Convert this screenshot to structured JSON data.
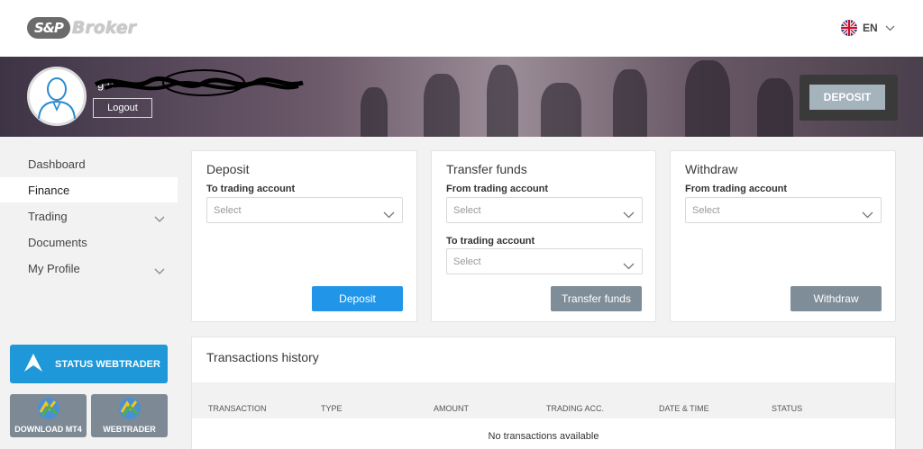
{
  "header": {
    "logo_mark": "S&P",
    "logo_text": "Broker",
    "language": "EN"
  },
  "banner": {
    "username": "g u",
    "logout_label": "Logout",
    "deposit_label": "DEPOSIT"
  },
  "sidebar": {
    "items": [
      {
        "label": "Dashboard"
      },
      {
        "label": "Finance"
      },
      {
        "label": "Trading"
      },
      {
        "label": "Documents"
      },
      {
        "label": "My Profile"
      }
    ],
    "status_webtrader": "STATUS WEBTRADER",
    "download_mt4": "DOWNLOAD MT4",
    "webtrader": "WEBTRADER"
  },
  "deposit_card": {
    "title": "Deposit",
    "to_label": "To trading account",
    "placeholder": "Select",
    "button": "Deposit"
  },
  "transfer_card": {
    "title": "Transfer funds",
    "from_label": "From trading account",
    "from_placeholder": "Select",
    "to_label": "To trading account",
    "to_placeholder": "Select",
    "button": "Transfer funds"
  },
  "withdraw_card": {
    "title": "Withdraw",
    "from_label": "From trading account",
    "placeholder": "Select",
    "button": "Withdraw"
  },
  "transactions": {
    "title": "Transactions history",
    "columns": [
      "TRANSACTION",
      "TYPE",
      "AMOUNT",
      "TRADING ACC.",
      "DATE & TIME",
      "STATUS"
    ],
    "empty_text": "No transactions available"
  },
  "colors": {
    "accent_blue": "#2196e8",
    "status_blue": "#1e98d8",
    "muted_button": "#7f8d98"
  }
}
